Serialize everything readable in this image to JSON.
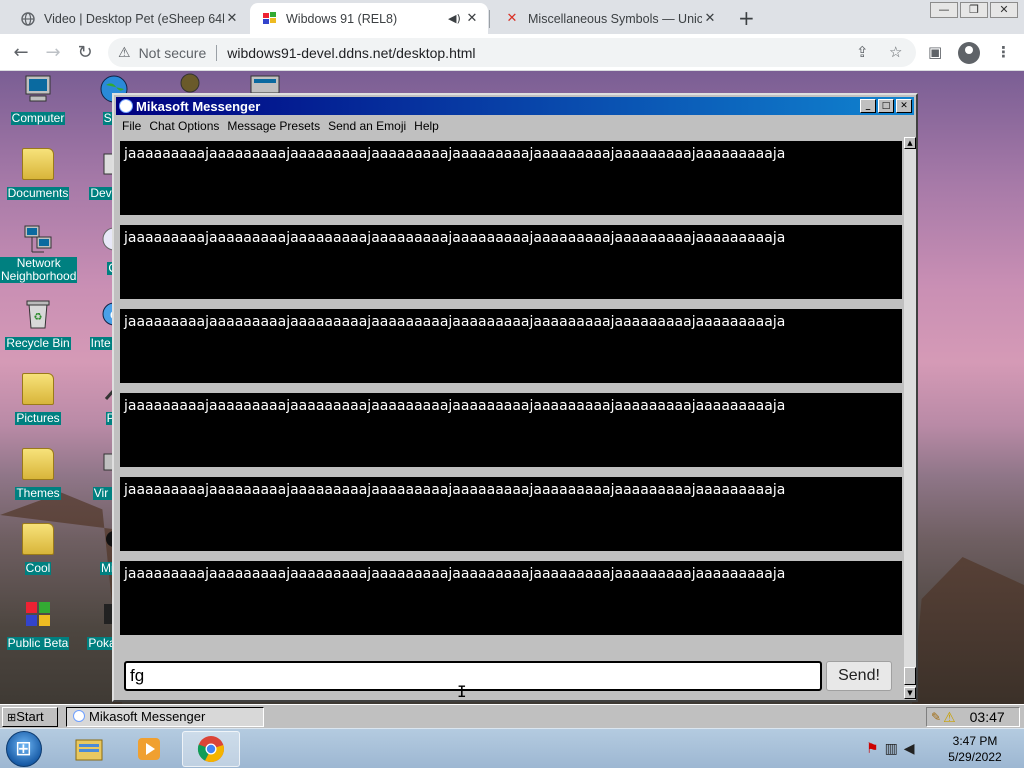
{
  "browser": {
    "tabs": [
      {
        "title": "Video | Desktop Pet (eSheep 64b",
        "icon": "globe-icon"
      },
      {
        "title": "Wibdows 91 (REL8)",
        "icon": "wibdows-icon"
      },
      {
        "title": "Miscellaneous Symbols — Unico",
        "icon": "unicode-icon"
      }
    ],
    "omnibox": {
      "security_label": "Not secure",
      "url": "wibdows91-devel.ddns.net/desktop.html"
    }
  },
  "desktop": {
    "icons": [
      {
        "label": "Computer",
        "icon": "computer-icon"
      },
      {
        "label": "Documents",
        "icon": "folder-icon"
      },
      {
        "label": "Network Neighborhood",
        "icon": "network-icon"
      },
      {
        "label": "Recycle Bin",
        "icon": "recycle-bin-icon"
      },
      {
        "label": "Pictures",
        "icon": "folder-icon"
      },
      {
        "label": "Themes",
        "icon": "folder-icon"
      },
      {
        "label": "Cool",
        "icon": "folder-icon"
      },
      {
        "label": "Public Beta",
        "icon": "public-beta-icon"
      }
    ],
    "icons_col2": [
      {
        "label": "Soc"
      },
      {
        "label": "Deve Ins"
      },
      {
        "label": "Cl"
      },
      {
        "label": "Inte Expl"
      },
      {
        "label": "Pa"
      },
      {
        "label": "Vir Mac"
      },
      {
        "label": "Mine"
      },
      {
        "label": "Poka Plat"
      }
    ]
  },
  "messenger": {
    "title": "Mikasoft Messenger",
    "menu": [
      "File",
      "Chat Options",
      "Message Presets",
      "Send an Emoji",
      "Help"
    ],
    "messages": [
      "jaaaaaaaaajaaaaaaaaajaaaaaaaaajaaaaaaaaajaaaaaaaaajaaaaaaaaajaaaaaaaaajaaaaaaaaaja",
      "jaaaaaaaaajaaaaaaaaajaaaaaaaaajaaaaaaaaajaaaaaaaaajaaaaaaaaajaaaaaaaaajaaaaaaaaaja",
      "jaaaaaaaaajaaaaaaaaajaaaaaaaaajaaaaaaaaajaaaaaaaaajaaaaaaaaajaaaaaaaaajaaaaaaaaaja",
      "jaaaaaaaaajaaaaaaaaajaaaaaaaaajaaaaaaaaajaaaaaaaaajaaaaaaaaajaaaaaaaaajaaaaaaaaaja",
      "jaaaaaaaaajaaaaaaaaajaaaaaaaaajaaaaaaaaajaaaaaaaaajaaaaaaaaajaaaaaaaaajaaaaaaaaaja",
      "jaaaaaaaaajaaaaaaaaajaaaaaaaaajaaaaaaaaajaaaaaaaaajaaaaaaaaajaaaaaaaaajaaaaaaaaaja"
    ],
    "input_value": "fg",
    "send_label": "Send!"
  },
  "wibdows_taskbar": {
    "start_label": "Start",
    "task_label": "Mikasoft Messenger",
    "clock": "03:47"
  },
  "win7_taskbar": {
    "time": "3:47 PM",
    "date": "5/29/2022"
  }
}
